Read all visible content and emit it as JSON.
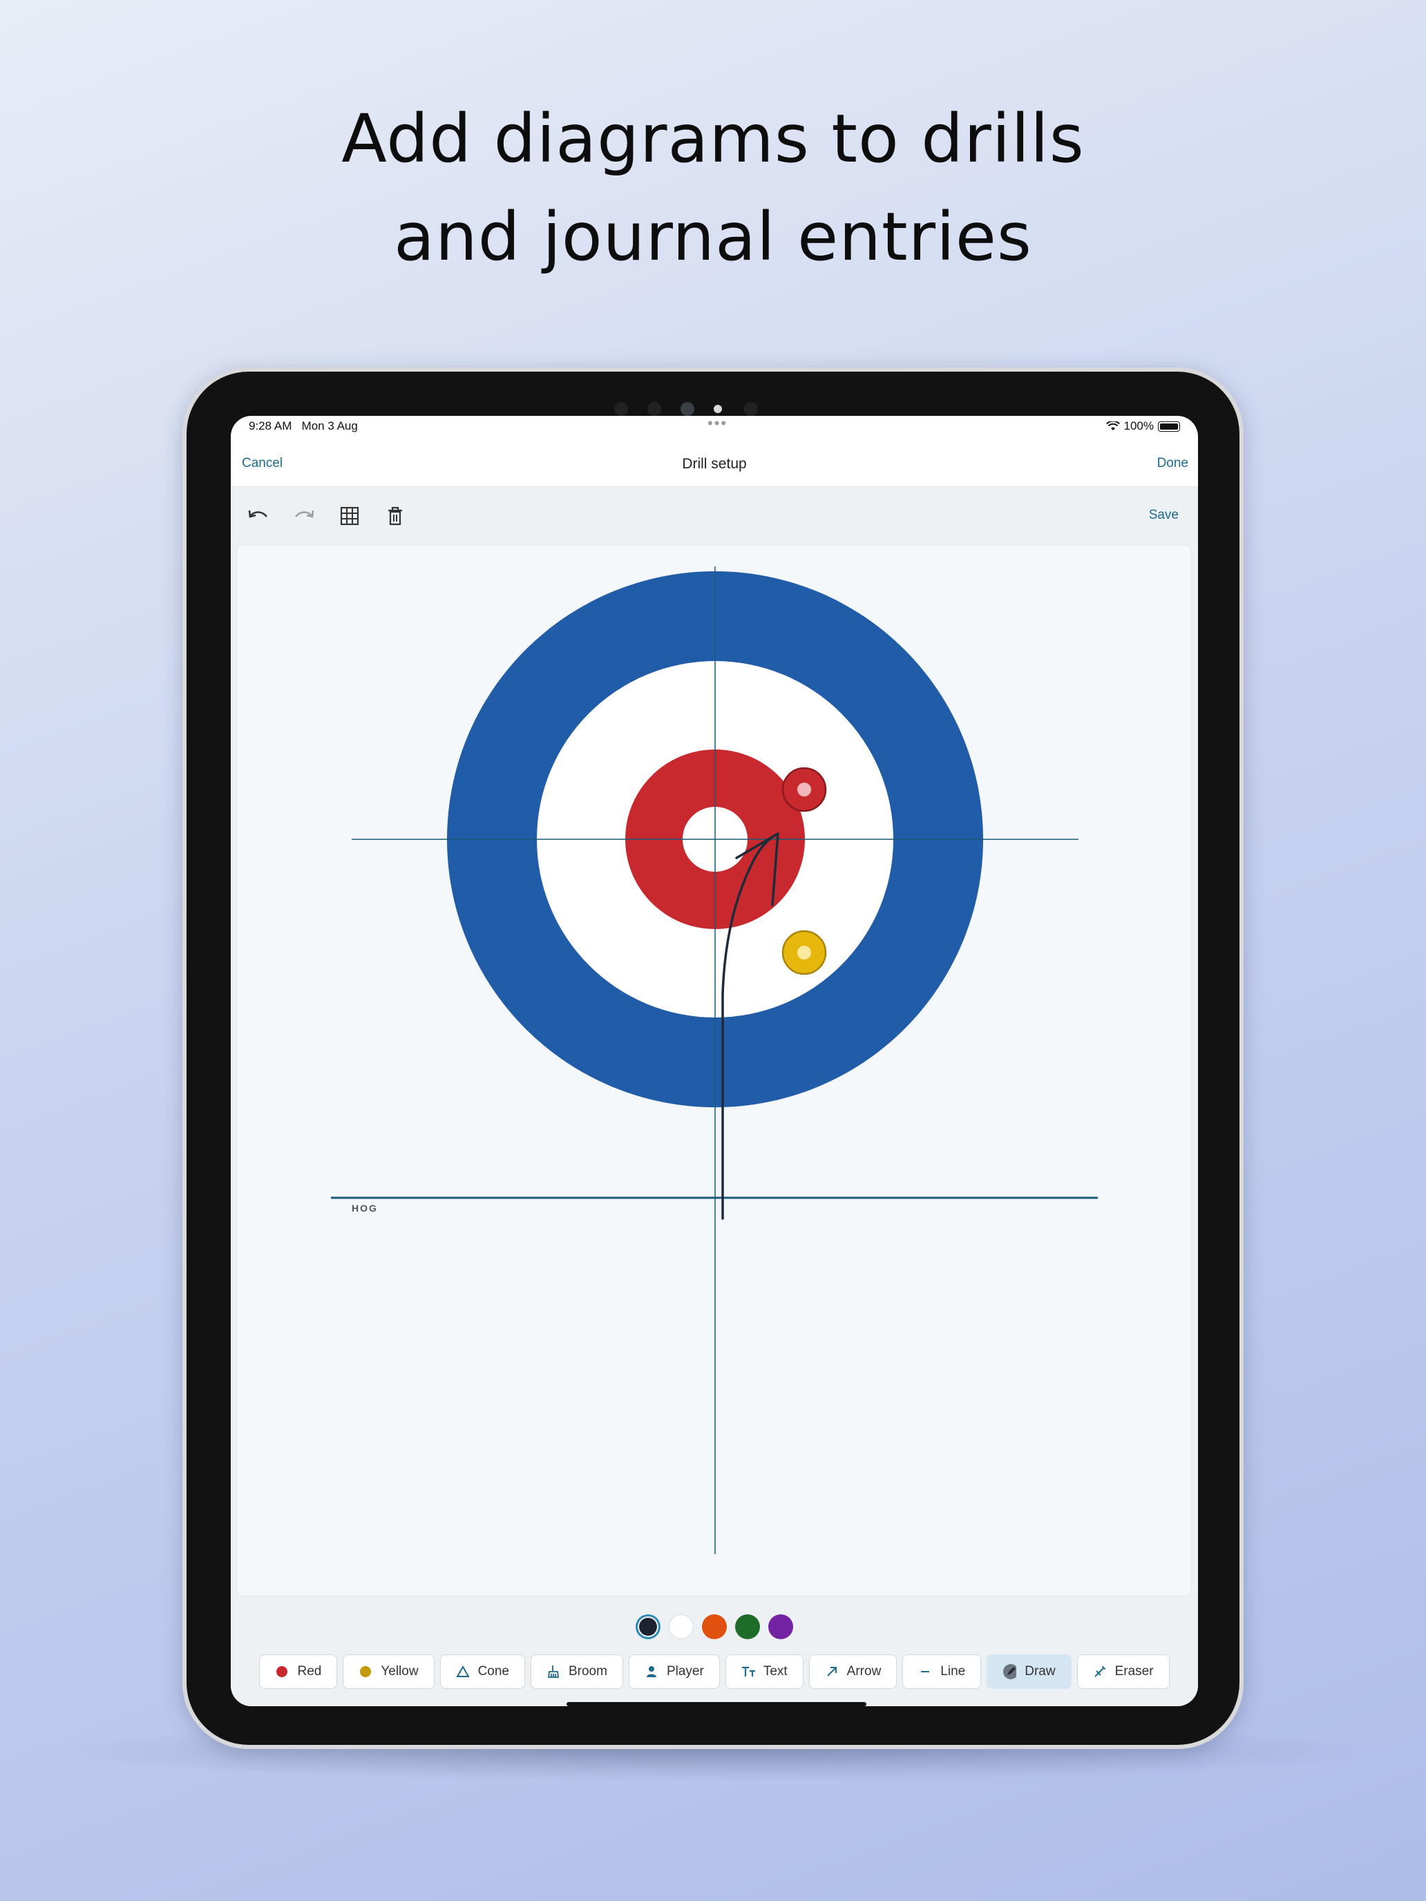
{
  "headline": {
    "line1": "Add diagrams to drills",
    "line2": "and journal entries"
  },
  "status_bar": {
    "time": "9:28 AM",
    "date": "Mon 3 Aug",
    "battery": "100%"
  },
  "nav": {
    "cancel": "Cancel",
    "title": "Drill setup",
    "done": "Done"
  },
  "toolbar": {
    "icons": [
      "undo-icon",
      "redo-icon",
      "grid-icon",
      "trash-icon"
    ],
    "save": "Save"
  },
  "diagram": {
    "hog_label": "HOG",
    "colors": {
      "blue_ring": "#215ca8",
      "red_ring": "#c8292e",
      "red_stone": "#c8292e",
      "yellow_stone": "#e6b70c",
      "lines": "#1a5a78",
      "drawn_arrow": "#1f2a3a"
    }
  },
  "palette": {
    "colors": [
      "#1b2230",
      "#ffffff",
      "#e0500f",
      "#1f6b2a",
      "#7422a4"
    ],
    "selected": "#1b2230"
  },
  "tools": [
    {
      "label": "Red",
      "icon": "red-stone-icon",
      "active": false
    },
    {
      "label": "Yellow",
      "icon": "yellow-stone-icon",
      "active": false
    },
    {
      "label": "Cone",
      "icon": "cone-icon",
      "active": false
    },
    {
      "label": "Broom",
      "icon": "broom-icon",
      "active": false
    },
    {
      "label": "Player",
      "icon": "player-icon",
      "active": false
    },
    {
      "label": "Text",
      "icon": "text-icon",
      "active": false
    },
    {
      "label": "Arrow",
      "icon": "arrow-icon",
      "active": false
    },
    {
      "label": "Line",
      "icon": "line-icon",
      "active": false
    },
    {
      "label": "Draw",
      "icon": "draw-icon",
      "active": true
    },
    {
      "label": "Eraser",
      "icon": "eraser-icon",
      "active": false
    }
  ]
}
